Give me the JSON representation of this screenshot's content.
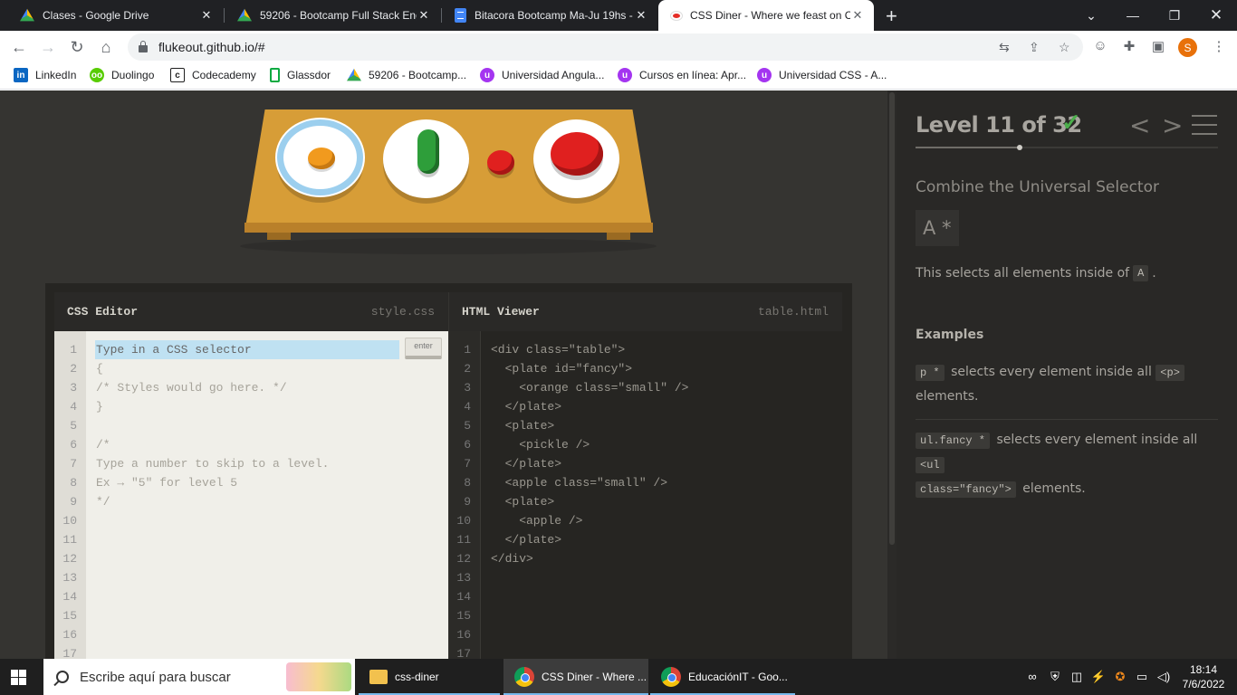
{
  "browser": {
    "tabs": [
      {
        "title": "Clases - Google Drive",
        "icon": "google-drive-icon",
        "active": false
      },
      {
        "title": "59206 - Bootcamp Full Stack Eng",
        "icon": "google-drive-icon",
        "active": false
      },
      {
        "title": "Bitacora Bootcamp Ma-Ju 19hs -",
        "icon": "google-docs-icon",
        "active": false
      },
      {
        "title": "CSS Diner - Where we feast on C",
        "icon": "css-diner-icon",
        "active": true
      }
    ],
    "new_tab": "+",
    "url": "flukeout.github.io/#",
    "profile_initial": "S",
    "bookmarks": [
      {
        "label": "LinkedIn",
        "icon": "linkedin-icon",
        "color": "#0a66c2"
      },
      {
        "label": "Duolingo",
        "icon": "duolingo-icon",
        "color": "#58cc02"
      },
      {
        "label": "Codecademy",
        "icon": "codecademy-icon",
        "color": "#1f1f1f"
      },
      {
        "label": "Glassdor",
        "icon": "glassdoor-icon",
        "color": "#0caa41"
      },
      {
        "label": "59206 - Bootcamp...",
        "icon": "google-drive-icon",
        "color": "#fbbc04"
      },
      {
        "label": "Universidad Angula...",
        "icon": "udemy-icon",
        "color": "#a435f0"
      },
      {
        "label": "Cursos en línea: Apr...",
        "icon": "udemy-icon",
        "color": "#a435f0"
      },
      {
        "label": "Universidad CSS - A...",
        "icon": "udemy-icon",
        "color": "#a435f0"
      }
    ]
  },
  "editor": {
    "css_title": "CSS Editor",
    "css_file": "style.css",
    "html_title": "HTML Viewer",
    "html_file": "table.html",
    "input_placeholder": "Type in a CSS selector",
    "enter_label": "enter",
    "line_numbers": [
      "1",
      "2",
      "3",
      "4",
      "5",
      "6",
      "7",
      "8",
      "9",
      "10",
      "11",
      "12",
      "13",
      "14",
      "15",
      "16",
      "17"
    ],
    "css_lines": [
      "",
      "{",
      "/* Styles would go here. */",
      "}",
      "",
      "/*",
      "Type a number to skip to a level.",
      "Ex → \"5\" for level 5",
      "*/"
    ],
    "html_lines": [
      "<div class=\"table\">",
      "  <plate id=\"fancy\">",
      "    <orange class=\"small\" />",
      "  </plate>",
      "  <plate>",
      "    <pickle />",
      "  </plate>",
      "  <apple class=\"small\" />",
      "  <plate>",
      "    <apple />",
      "  </plate>",
      "</div>"
    ]
  },
  "level": {
    "heading": "Level 11 of 32",
    "completed": true,
    "current": 11,
    "total": 32,
    "title": "Combine the Universal Selector",
    "syntax": "A  *",
    "hint_pre": "This selects all elements inside of",
    "hint_tag": "A",
    "hint_post": ".",
    "examples_heading": "Examples",
    "example1_code": "p  *",
    "example1_text": "selects every element inside all",
    "example1_tag": "<p>",
    "example1_post": "elements.",
    "example2_code": "ul.fancy  *",
    "example2_text": "selects every element inside all",
    "example2_tag1": "<ul",
    "example2_tag2": "class=\"fancy\">",
    "example2_post": "elements."
  },
  "taskbar": {
    "search_placeholder": "Escribe aquí para buscar",
    "apps": [
      {
        "label": "css-diner",
        "icon": "folder-icon",
        "active": false
      },
      {
        "label": "CSS Diner - Where ...",
        "icon": "chrome-icon",
        "active": true
      },
      {
        "label": "EducaciónIT - Goo...",
        "icon": "chrome-icon",
        "active": false
      }
    ],
    "time": "18:14",
    "date": "7/6/2022"
  }
}
